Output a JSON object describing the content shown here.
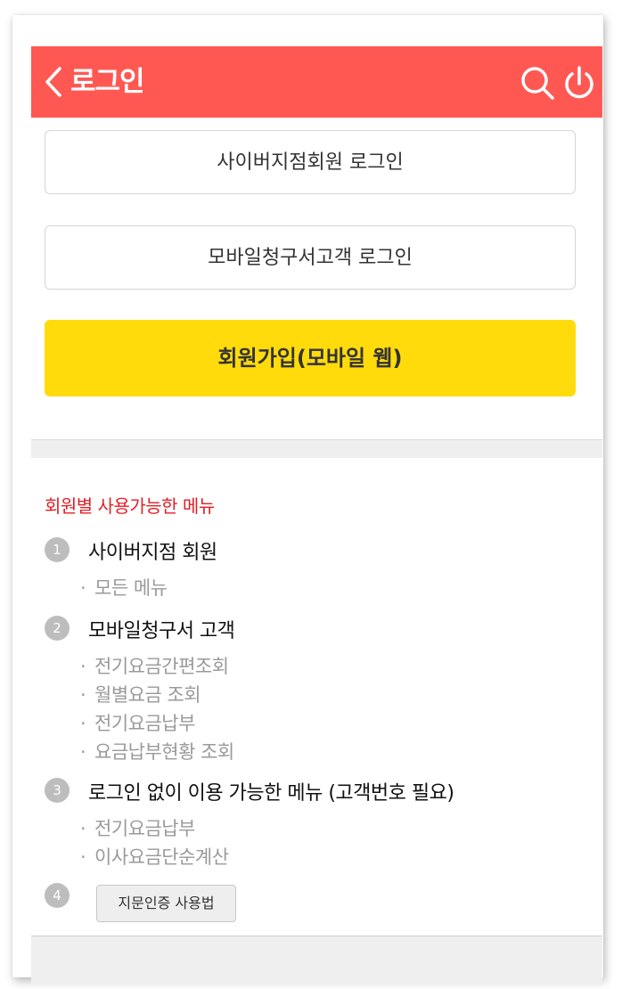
{
  "header": {
    "title": "로그인",
    "back_icon": "chevron-left-icon",
    "search_icon": "search-icon",
    "power_icon": "power-icon",
    "color": "#ff5853"
  },
  "login": {
    "cyber_member": "사이버지점회원 로그인",
    "mobile_bill": "모바일청구서고객 로그인",
    "signup": "회원가입(모바일 웹)",
    "signup_color": "#ffdb0b"
  },
  "menu": {
    "title": "회원별 사용가능한 메뉴",
    "sections": [
      {
        "num": "1",
        "title": "사이버지점 회원",
        "items": [
          "모든 메뉴"
        ]
      },
      {
        "num": "2",
        "title": "모바일청구서 고객",
        "items": [
          "전기요금간편조회",
          "월별요금 조회",
          "전기요금납부",
          "요금납부현황 조회"
        ]
      },
      {
        "num": "3",
        "title": "로그인 없이 이용 가능한 메뉴 (고객번호 필요)",
        "items": [
          "전기요금납부",
          "이사요금단순계산"
        ]
      },
      {
        "num": "4",
        "button": "지문인증 사용법"
      }
    ],
    "bullet": "·"
  }
}
